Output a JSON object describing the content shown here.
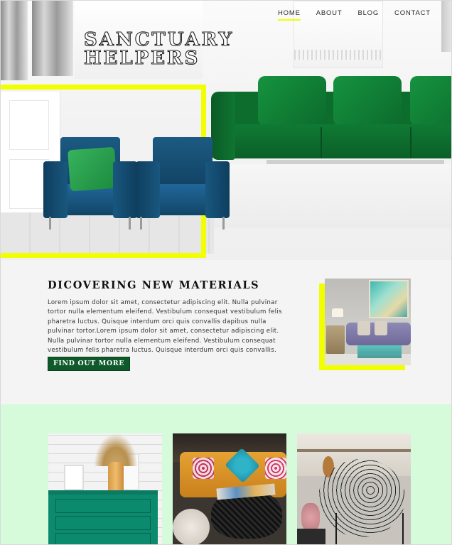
{
  "site": {
    "brand_line1": "SANCTUARY",
    "brand_line2": "HELPERS"
  },
  "nav": {
    "items": [
      {
        "label": "HOME",
        "active": true
      },
      {
        "label": "ABOUT",
        "active": false
      },
      {
        "label": "BLOG",
        "active": false
      },
      {
        "label": "CONTACT",
        "active": false
      }
    ]
  },
  "about": {
    "heading": "DICOVERING NEW MATERIALS",
    "body": "Lorem ipsum dolor sit amet, consectetur adipiscing elit. Nulla pulvinar tortor nulla elementum eleifend. Vestibulum consequat vestibulum felis pharetra luctus. Quisque interdum orci quis convallis dapibus nulla pulvinar tortor.Lorem ipsum dolor sit amet, consectetur adipiscing elit. Nulla pulvinar tortor nulla elementum eleifend. Vestibulum consequat vestibulum felis pharetra luctus. Quisque interdum orci quis convallis.",
    "cta_label": "FIND OUT MORE"
  },
  "colors": {
    "accent_yellow": "#f1ff00",
    "cta_green": "#0f5a2b",
    "gallery_bg": "#d6fbdb"
  }
}
